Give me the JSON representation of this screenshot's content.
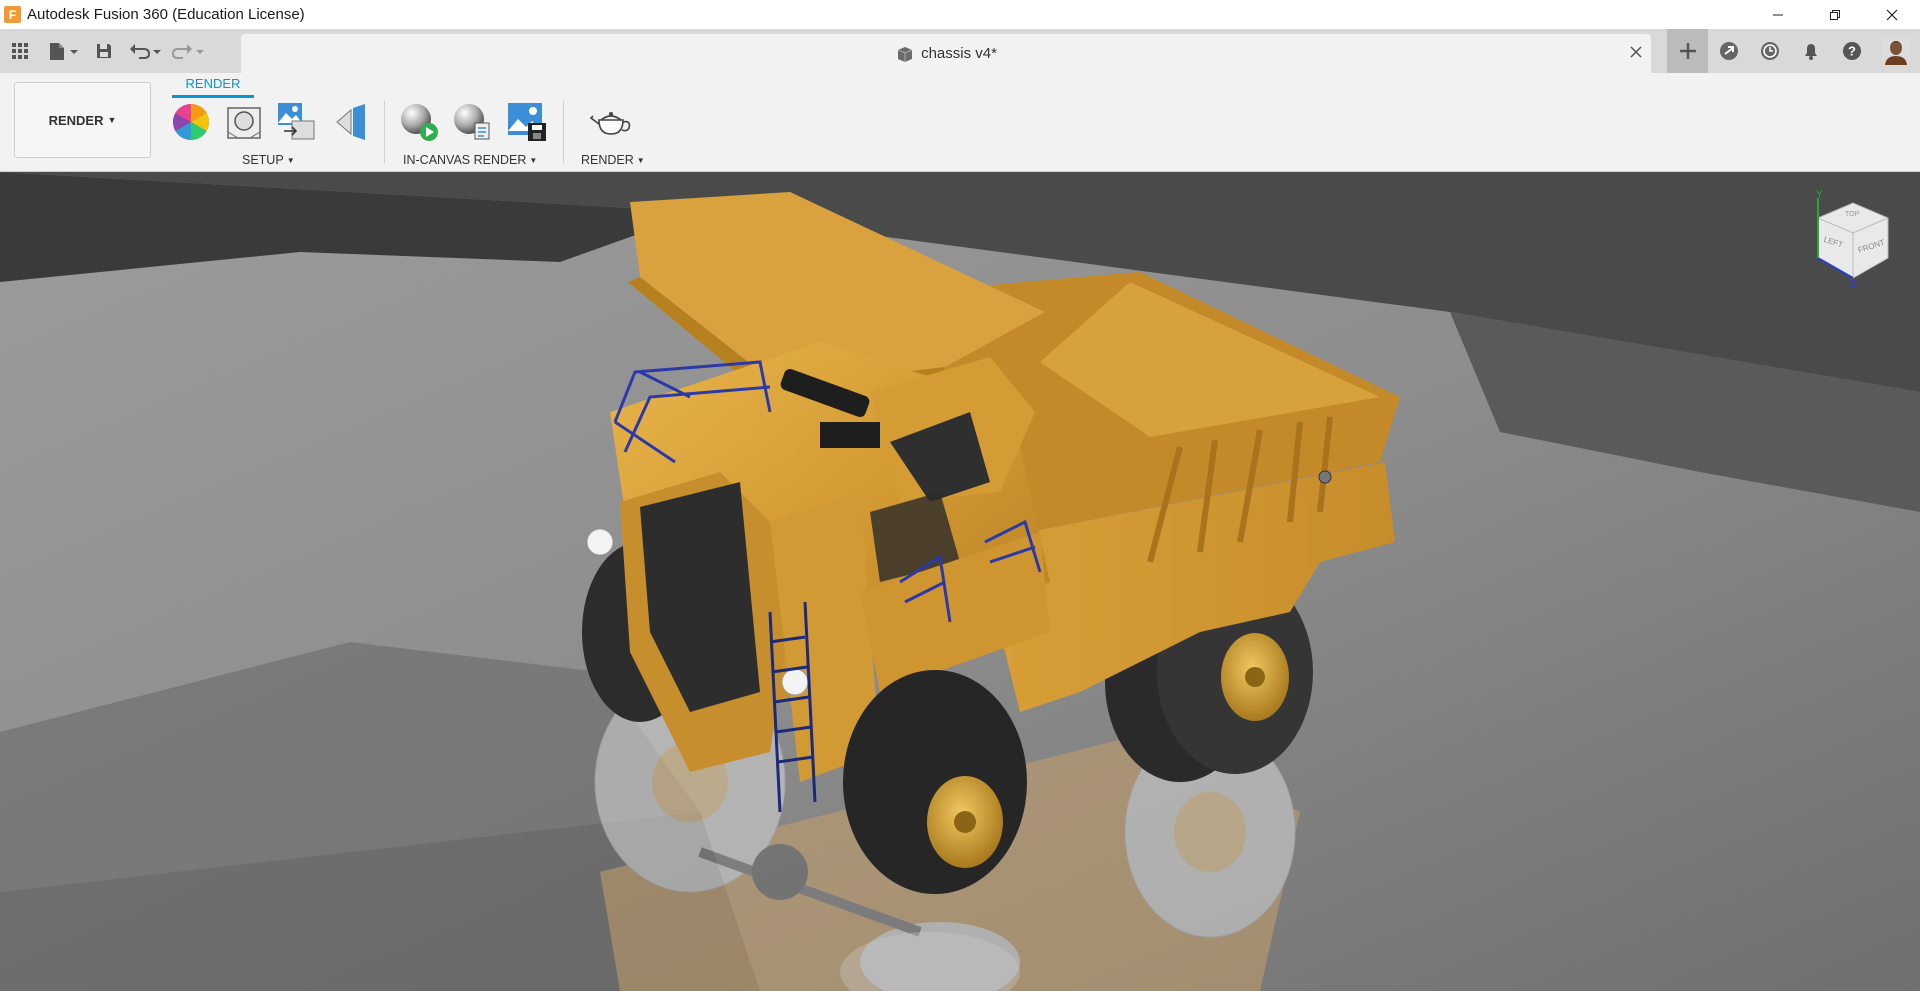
{
  "window": {
    "title": "Autodesk Fusion 360 (Education License)",
    "logo_letter": "F"
  },
  "document_tab": {
    "title": "chassis v4*"
  },
  "toolbar": {
    "workspace_label": "RENDER",
    "active_tab": "RENDER",
    "groups": {
      "setup": "SETUP",
      "in_canvas": "IN-CANVAS RENDER",
      "render": "RENDER"
    }
  },
  "viewcube": {
    "faces": [
      "TOP",
      "LEFT",
      "FRONT"
    ],
    "axes": [
      "Y",
      "Z"
    ]
  },
  "colors": {
    "accent": "#0696d7",
    "truck_body": "#d9a13a",
    "canvas_bg": "#8a8a8a"
  },
  "icons": {
    "grid": "apps-grid-icon",
    "file": "file-icon",
    "save": "save-icon",
    "undo": "undo-icon",
    "redo": "redo-icon",
    "new_tab": "plus-icon",
    "extensions": "extensions-icon",
    "job_status": "clock-icon",
    "notifications": "bell-icon",
    "help": "help-icon"
  }
}
